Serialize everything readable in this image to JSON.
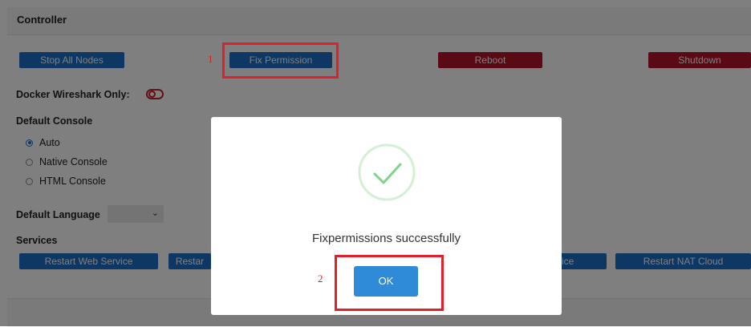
{
  "controller": {
    "title": "Controller",
    "stop_all_nodes": "Stop All Nodes",
    "fix_permission": "Fix Permission",
    "reboot": "Reboot",
    "shutdown": "Shutdown"
  },
  "docker_wireshark": {
    "label": "Docker Wireshark Only:"
  },
  "default_console": {
    "label": "Default Console",
    "options": [
      {
        "label": "Auto",
        "checked": true
      },
      {
        "label": "Native Console",
        "checked": false
      },
      {
        "label": "HTML Console",
        "checked": false
      }
    ]
  },
  "default_language": {
    "label": "Default Language",
    "selected": ""
  },
  "services": {
    "label": "Services",
    "buttons": [
      "Restart Web Service",
      "Restar",
      "rvice",
      "Restart NAT Cloud"
    ]
  },
  "annotations": [
    "1",
    "2"
  ],
  "dialog": {
    "message": "Fixpermissions successfully",
    "ok": "OK",
    "icon": "check-circle-icon"
  },
  "colors": {
    "primary_blue": "#1d6fc9",
    "danger_red": "#b3152a",
    "ok_blue": "#2f8ad7",
    "annotation_red": "#e0202a",
    "success_green": "#7dd48a"
  }
}
